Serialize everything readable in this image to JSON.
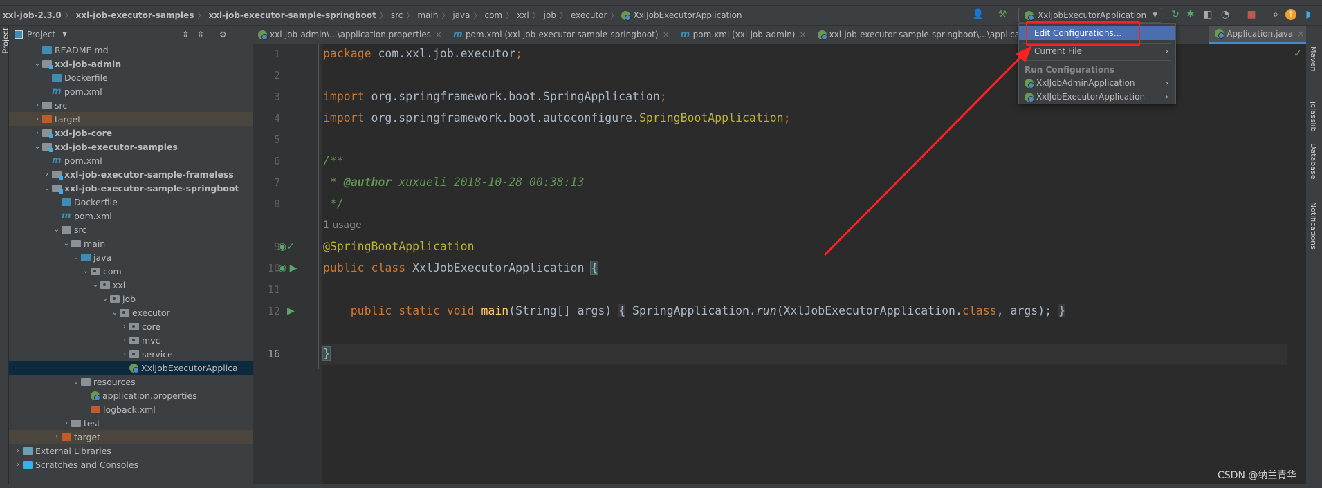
{
  "breadcrumb": [
    "xxl-job-2.3.0",
    "xxl-job-executor-samples",
    "xxl-job-executor-sample-springboot",
    "src",
    "main",
    "java",
    "com",
    "xxl",
    "job",
    "executor",
    "XxlJobExecutorApplication"
  ],
  "run_config": {
    "selected": "XxlJobExecutorApplication"
  },
  "project_panel": {
    "title": "Project",
    "label": "Project"
  },
  "tree": [
    {
      "label": "README.md",
      "icon": "markdown-icon"
    },
    {
      "label": "xxl-job-admin",
      "icon": "module-folder-icon"
    },
    {
      "label": "Dockerfile",
      "icon": "docker-file-icon"
    },
    {
      "label": "pom.xml",
      "icon": "maven-icon"
    },
    {
      "label": "src",
      "icon": "folder-icon"
    },
    {
      "label": "target",
      "icon": "excluded-folder-icon"
    },
    {
      "label": "xxl-job-core",
      "icon": "module-folder-icon"
    },
    {
      "label": "xxl-job-executor-samples",
      "icon": "module-folder-icon"
    },
    {
      "label": "pom.xml",
      "icon": "maven-icon"
    },
    {
      "label": "xxl-job-executor-sample-frameless",
      "icon": "module-folder-icon"
    },
    {
      "label": "xxl-job-executor-sample-springboot",
      "icon": "module-folder-icon"
    },
    {
      "label": "Dockerfile",
      "icon": "docker-file-icon"
    },
    {
      "label": "pom.xml",
      "icon": "maven-icon"
    },
    {
      "label": "src",
      "icon": "folder-icon"
    },
    {
      "label": "main",
      "icon": "folder-icon"
    },
    {
      "label": "java",
      "icon": "source-folder-icon"
    },
    {
      "label": "com",
      "icon": "package-icon"
    },
    {
      "label": "xxl",
      "icon": "package-icon"
    },
    {
      "label": "job",
      "icon": "package-icon"
    },
    {
      "label": "executor",
      "icon": "package-icon"
    },
    {
      "label": "core",
      "icon": "package-icon"
    },
    {
      "label": "mvc",
      "icon": "package-icon"
    },
    {
      "label": "service",
      "icon": "package-icon"
    },
    {
      "label": "XxlJobExecutorApplica",
      "icon": "spring-boot-class-icon"
    },
    {
      "label": "resources",
      "icon": "resources-folder-icon"
    },
    {
      "label": "application.properties",
      "icon": "spring-properties-icon"
    },
    {
      "label": "logback.xml",
      "icon": "xml-file-icon"
    },
    {
      "label": "test",
      "icon": "folder-icon"
    },
    {
      "label": "target",
      "icon": "excluded-folder-icon"
    },
    {
      "label": "External Libraries",
      "icon": "libraries-icon"
    },
    {
      "label": "Scratches and Consoles",
      "icon": "scratches-icon"
    }
  ],
  "tabs": [
    {
      "label": "xxl-job-admin\\...\\application.properties"
    },
    {
      "label": "pom.xml (xxl-job-executor-sample-springboot)"
    },
    {
      "label": "pom.xml (xxl-job-admin)"
    },
    {
      "label": "xxl-job-executor-sample-springboot\\...\\applica"
    },
    {
      "label": "Application.java"
    }
  ],
  "editor": {
    "line_numbers": [
      "1",
      "2",
      "3",
      "4",
      "5",
      "6",
      "7",
      "8",
      "9",
      "10",
      "11",
      "12",
      "",
      "16"
    ],
    "usage_hint": "1 usage",
    "code": {
      "l1_kw": "package",
      "l1_rest": " com.xxl.job.executor",
      "semi": ";",
      "import": "import",
      "l3": " org.springframework.boot.SpringApplication",
      "l4a": " org.springframework.boot.autoconfigure.",
      "l4b": "SpringBootApplication",
      "l6": "/**",
      "l7a": " * ",
      "l7tag": "@author",
      "l7b": " xuxueli 2018-10-28 00:38:13",
      "l8": " */",
      "l9": "@SpringBootApplication",
      "l10kw": "public class",
      "l10name": " XxlJobExecutorApplication ",
      "lbrace": "{",
      "l12kw": "public static void",
      "l12fn": " main",
      "l12a": "(String[] args) ",
      "l12b": " SpringApplication.",
      "l12run": "run",
      "l12c": "(XxlJobExecutorApplication.",
      "l12cls": "class",
      "l12d": ", args);",
      "l12e": " ",
      "rbrace": "}"
    }
  },
  "menu": {
    "edit": "Edit Configurations...",
    "current_file": "Current File",
    "run_header": "Run Configurations",
    "items": [
      "XxlJobAdminApplication",
      "XxlJobExecutorApplication"
    ]
  },
  "right_tools": [
    "Maven",
    "jclasslib",
    "Database",
    "Notifications"
  ],
  "watermark": "CSDN @纳兰青华",
  "colors": {
    "accent": "#4b6eaf",
    "annotation_red": "#ff2020"
  }
}
